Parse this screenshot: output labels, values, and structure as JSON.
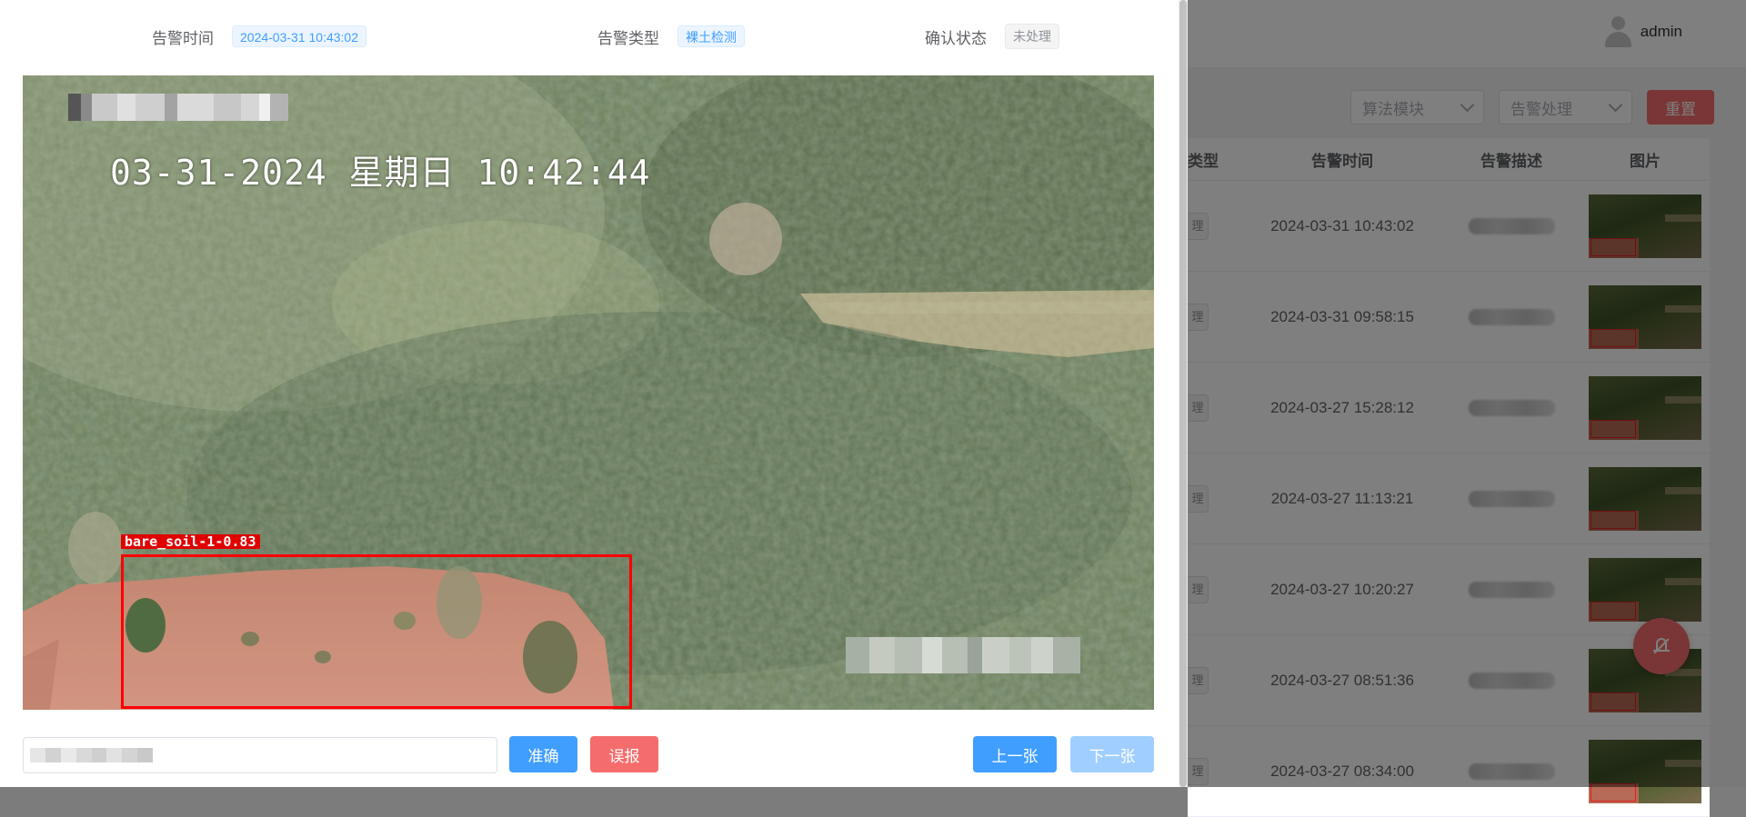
{
  "dialog": {
    "alarm_time_label": "告警时间",
    "alarm_time_value": "2024-03-31 10:43:02",
    "alarm_type_label": "告警类型",
    "alarm_type_value": "裸土检测",
    "confirm_status_label": "确认状态",
    "confirm_status_value": "未处理",
    "image": {
      "osd_timestamp": "03-31-2024 星期日 10:42:44",
      "detection_label": "bare_soil-1-0.83"
    },
    "remark_value": "",
    "buttons": {
      "accurate": "准确",
      "false_alarm": "误报",
      "previous": "上一张",
      "next": "下一张"
    }
  },
  "background": {
    "user": {
      "name": "admin"
    },
    "filters": {
      "algorithm_module": "算法模块",
      "alarm_handling": "告警处理",
      "reset": "重置"
    },
    "table": {
      "columns": {
        "type": "类型",
        "time": "告警时间",
        "description": "告警描述",
        "image": "图片"
      },
      "rows": [
        {
          "type": "理",
          "time": "2024-03-31 10:43:02"
        },
        {
          "type": "理",
          "time": "2024-03-31 09:58:15"
        },
        {
          "type": "理",
          "time": "2024-03-27 15:28:12"
        },
        {
          "type": "理",
          "time": "2024-03-27 11:13:21"
        },
        {
          "type": "理",
          "time": "2024-03-27 10:20:27"
        },
        {
          "type": "理",
          "time": "2024-03-27 08:51:36"
        },
        {
          "type": "理",
          "time": "2024-03-27 08:34:00"
        }
      ]
    }
  },
  "colors": {
    "primary": "#409eff",
    "danger": "#f56c6c",
    "primary_light": "#a0cfff",
    "detection_box": "#ff0000"
  },
  "icons": [
    "user-avatar-icon",
    "chevron-down-icon",
    "bell-off-icon"
  ]
}
